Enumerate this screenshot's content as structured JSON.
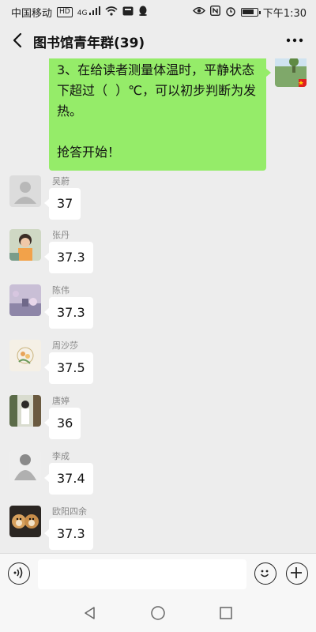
{
  "status_bar": {
    "carrier": "中国移动",
    "hd": "HD",
    "signal_label": "4G",
    "time": "下午1:30"
  },
  "header": {
    "title": "图书馆青年群(39)",
    "back_icon": "chevron-left-icon",
    "more_icon": "more-dots-icon"
  },
  "my_message": {
    "text": "3、在给读者测量体温时，平静状态下超过（  ）℃，可以初步判断为发热。\n\n抢答开始！"
  },
  "messages": [
    {
      "sender": "吴蔚",
      "text": "37"
    },
    {
      "sender": "张丹",
      "text": "37.3"
    },
    {
      "sender": "陈伟",
      "text": "37.3"
    },
    {
      "sender": "周沙莎",
      "text": "37.5"
    },
    {
      "sender": "唐婷",
      "text": "36"
    },
    {
      "sender": "李成",
      "text": "37.4"
    },
    {
      "sender": "欧阳四余",
      "text": "37.3"
    }
  ],
  "colors": {
    "my_bubble": "#95ec69",
    "background": "#ededed",
    "other_bubble": "#ffffff"
  },
  "input_bar": {
    "voice_icon": "voice-icon",
    "emoji_icon": "emoji-icon",
    "plus_icon": "plus-icon"
  }
}
